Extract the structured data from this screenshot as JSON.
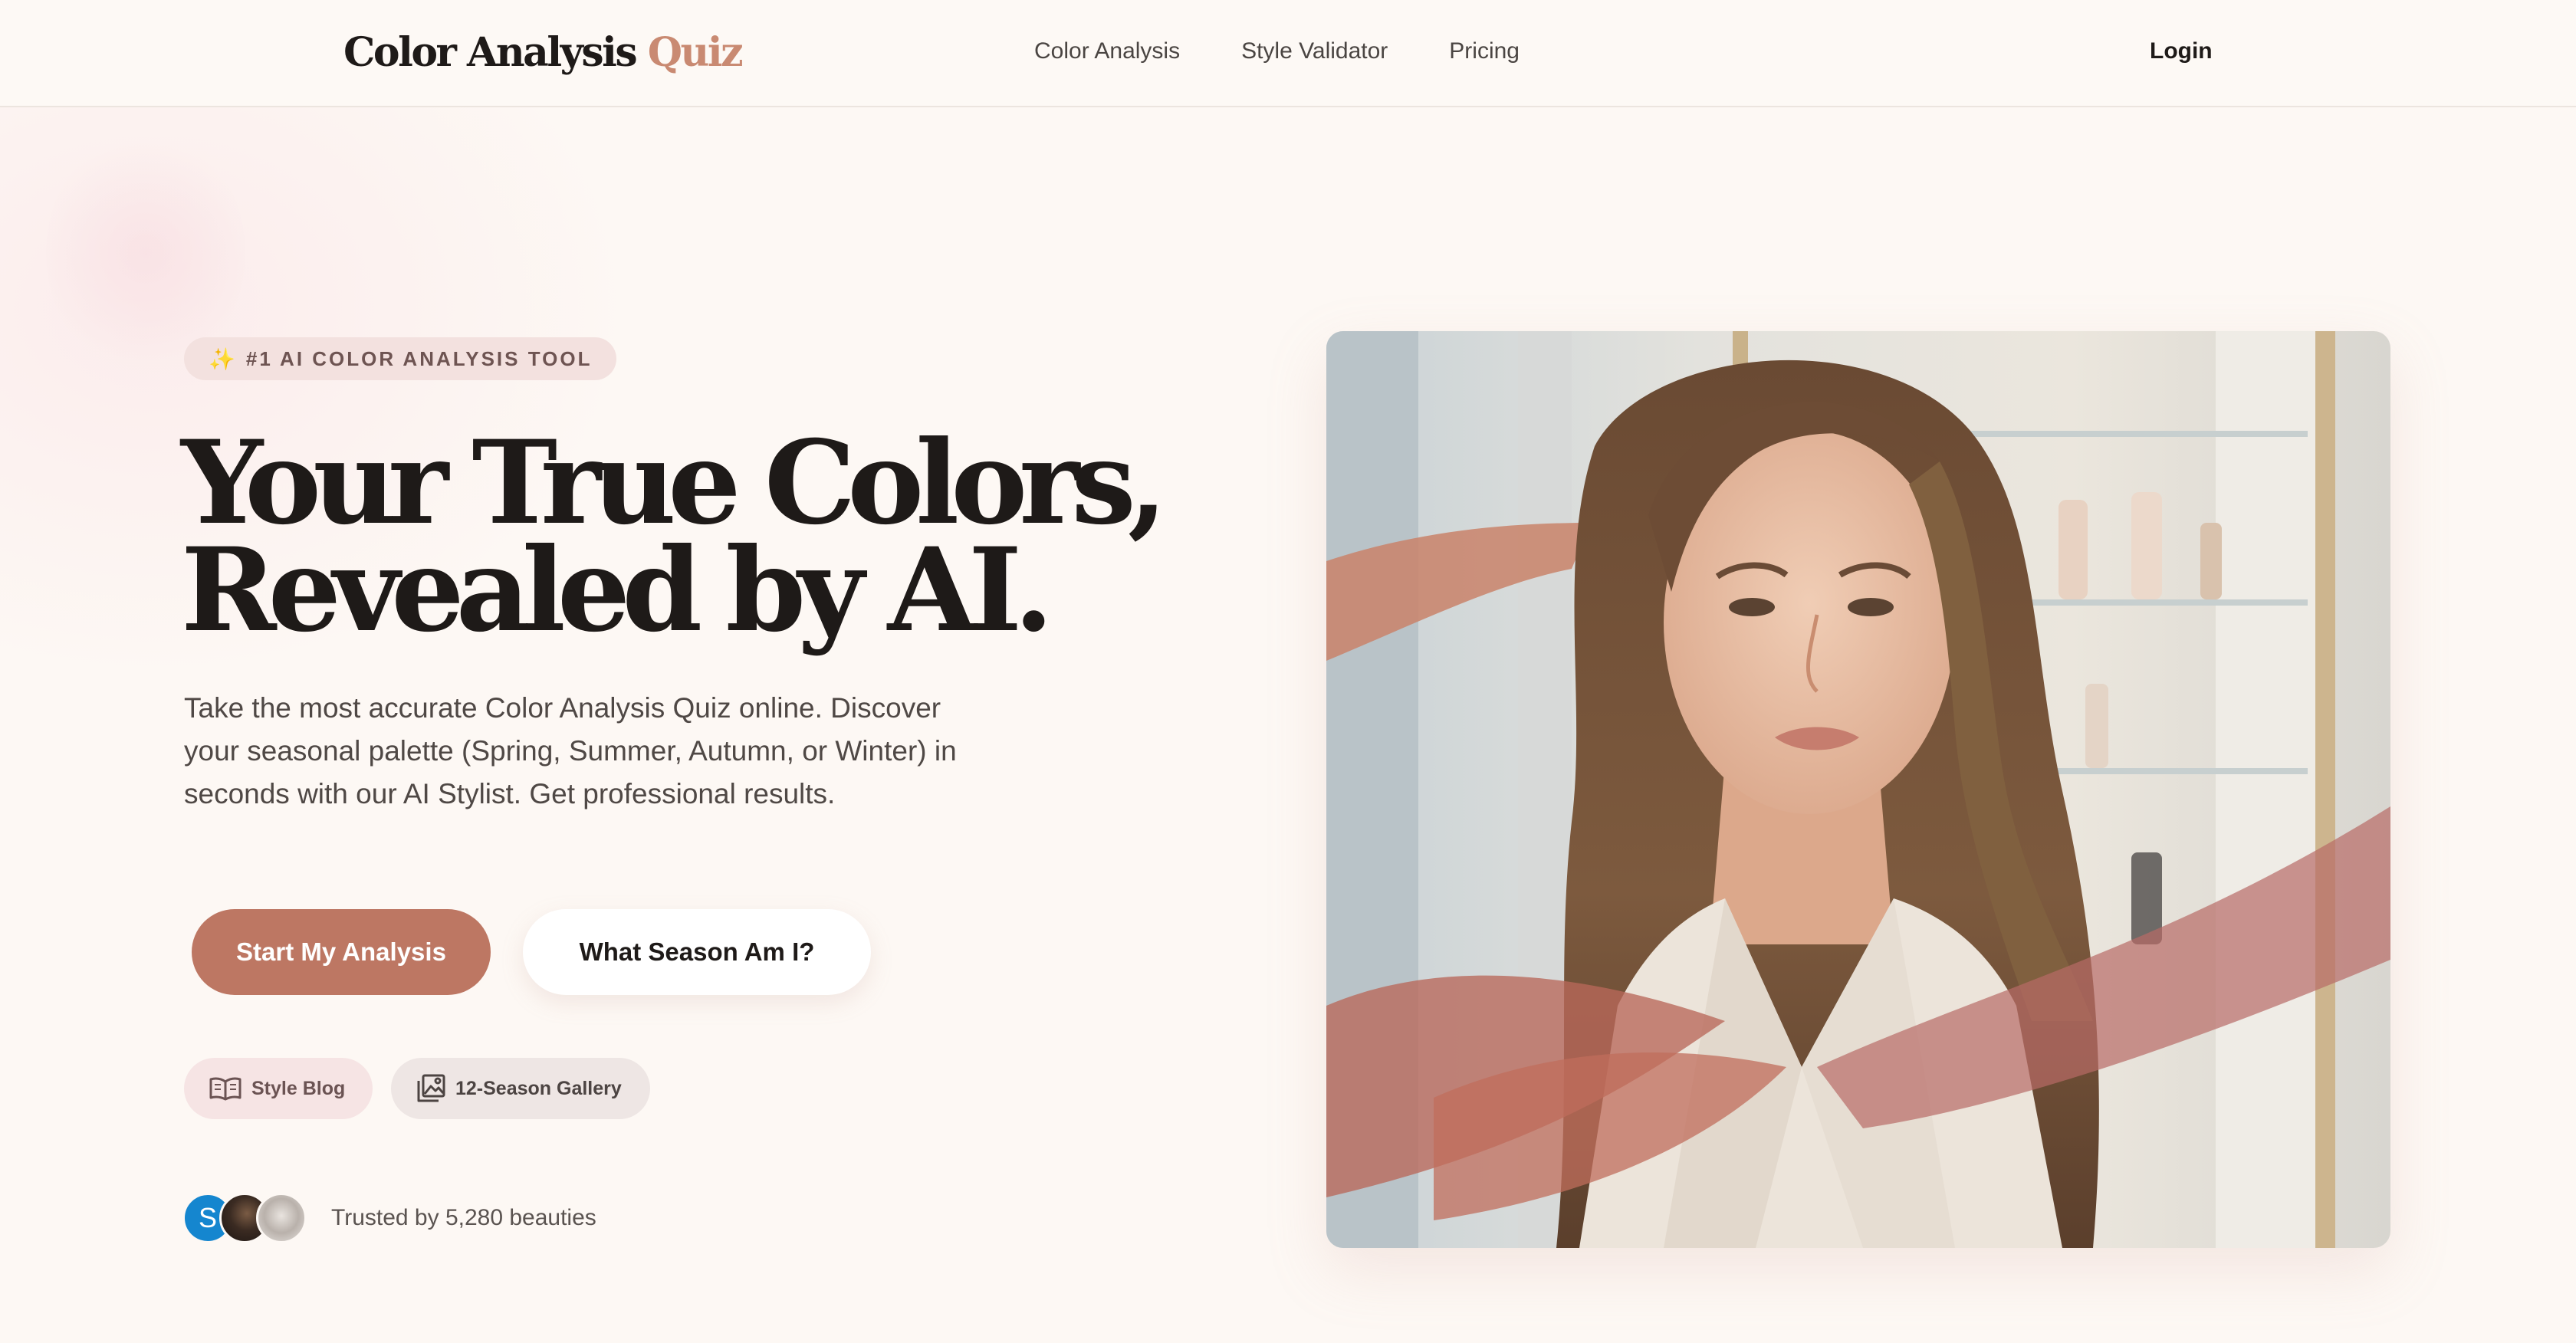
{
  "header": {
    "logo_main": "Color Analysis",
    "logo_accent": "Quiz",
    "nav": [
      "Color Analysis",
      "Style Validator",
      "Pricing"
    ],
    "login": "Login"
  },
  "hero": {
    "badge_icon": "sparkle-icon",
    "badge_text": "#1 AI COLOR ANALYSIS TOOL",
    "headline_line1": "Your True Colors,",
    "headline_line2": "Revealed by AI.",
    "description": "Take the most accurate Color Analysis Quiz online. Discover your seasonal palette (Spring, Summer, Autumn, or Winter) in seconds with our AI Stylist. Get professional results.",
    "primary_cta": "Start My Analysis",
    "secondary_cta": "What Season Am I?",
    "chips": [
      {
        "icon": "book-icon",
        "label": "Style Blog"
      },
      {
        "icon": "gallery-icon",
        "label": "12-Season Gallery"
      }
    ],
    "avatar_initial": "S",
    "trust_text": "Trusted by 5,280 beauties"
  },
  "colors": {
    "background": "#fdf8f4",
    "accent": "#bd7763",
    "logo_accent": "#c98a72",
    "badge_bg": "#f3e1df"
  }
}
